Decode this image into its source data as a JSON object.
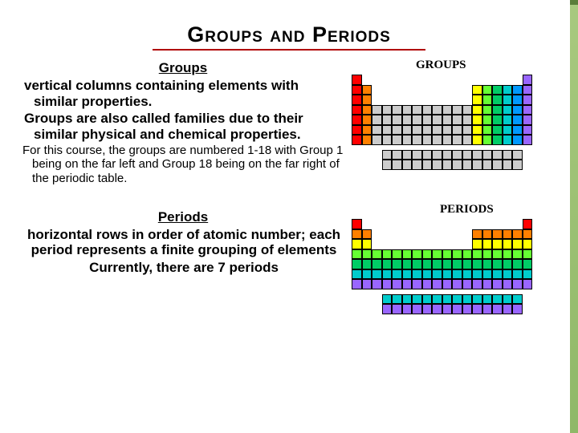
{
  "title": "Groups and Periods",
  "sections": {
    "groups": {
      "heading": "Groups",
      "def": "vertical columns containing elements with similar properties.",
      "note": "Groups are also called families due to their similar physical and chemical properties.",
      "course": "For this course, the groups are numbered 1-18 with Group 1 being on the far left and Group 18 being on the far right of the periodic table."
    },
    "periods": {
      "heading": "Periods",
      "def": "horizontal rows in order of atomic number; each period represents a finite grouping of elements",
      "count": "Currently, there are 7 periods"
    }
  },
  "figures": {
    "groups_label": "GROUPS",
    "periods_label": "PERIODS"
  },
  "group_colors": [
    "#ff0000",
    "#ff8000",
    "#cccccc",
    "#cccccc",
    "#cccccc",
    "#cccccc",
    "#cccccc",
    "#cccccc",
    "#cccccc",
    "#cccccc",
    "#cccccc",
    "#cccccc",
    "#ffff00",
    "#66ff33",
    "#00cc66",
    "#00cccc",
    "#0099ff",
    "#9966ff"
  ],
  "period_colors": [
    "#ff0000",
    "#ff8000",
    "#ffff00",
    "#66ff33",
    "#00cc66",
    "#00cccc",
    "#9966ff"
  ],
  "pt_layout": {
    "cols_per_row": [
      [
        0,
        17
      ],
      [
        0,
        1,
        12,
        13,
        14,
        15,
        16,
        17
      ],
      [
        0,
        1,
        12,
        13,
        14,
        15,
        16,
        17
      ],
      [
        0,
        1,
        2,
        3,
        4,
        5,
        6,
        7,
        8,
        9,
        10,
        11,
        12,
        13,
        14,
        15,
        16,
        17
      ],
      [
        0,
        1,
        2,
        3,
        4,
        5,
        6,
        7,
        8,
        9,
        10,
        11,
        12,
        13,
        14,
        15,
        16,
        17
      ],
      [
        0,
        1,
        2,
        3,
        4,
        5,
        6,
        7,
        8,
        9,
        10,
        11,
        12,
        13,
        14,
        15,
        16,
        17
      ],
      [
        0,
        1,
        2,
        3,
        4,
        5,
        6,
        7,
        8,
        9,
        10,
        11,
        12,
        13,
        14,
        15,
        16,
        17
      ]
    ],
    "f_block": [
      [
        3,
        4,
        5,
        6,
        7,
        8,
        9,
        10,
        11,
        12,
        13,
        14,
        15,
        16
      ],
      [
        3,
        4,
        5,
        6,
        7,
        8,
        9,
        10,
        11,
        12,
        13,
        14,
        15,
        16
      ]
    ]
  }
}
